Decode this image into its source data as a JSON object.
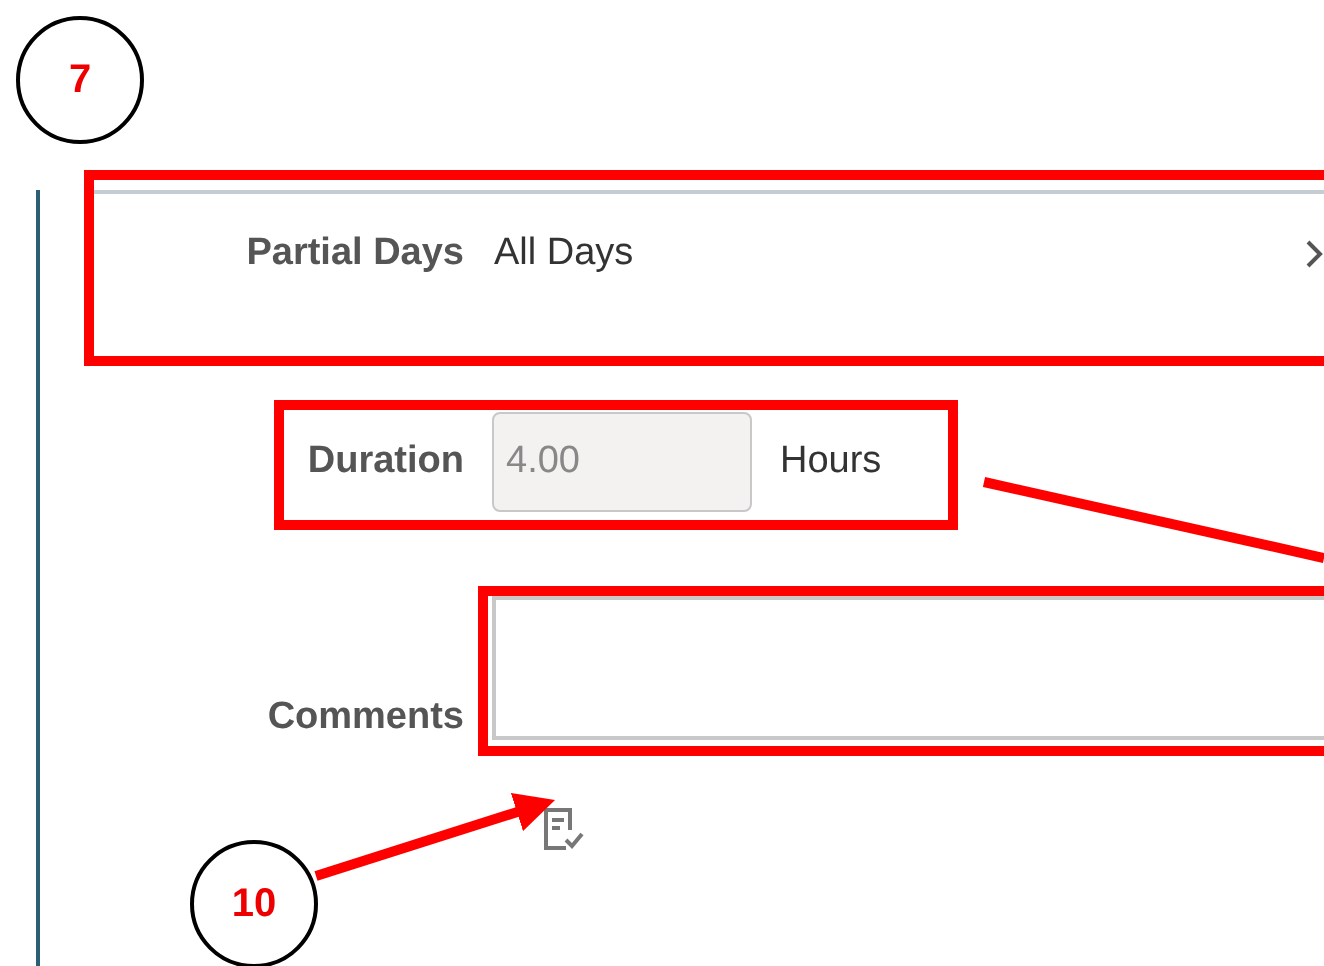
{
  "callouts": [
    {
      "label": "7"
    },
    {
      "label": "10"
    }
  ],
  "partial_days": {
    "label": "Partial Days",
    "value": "All Days"
  },
  "duration": {
    "label": "Duration",
    "value": "4.00",
    "unit": "Hours",
    "disabled": true
  },
  "comments": {
    "label": "Comments"
  }
}
